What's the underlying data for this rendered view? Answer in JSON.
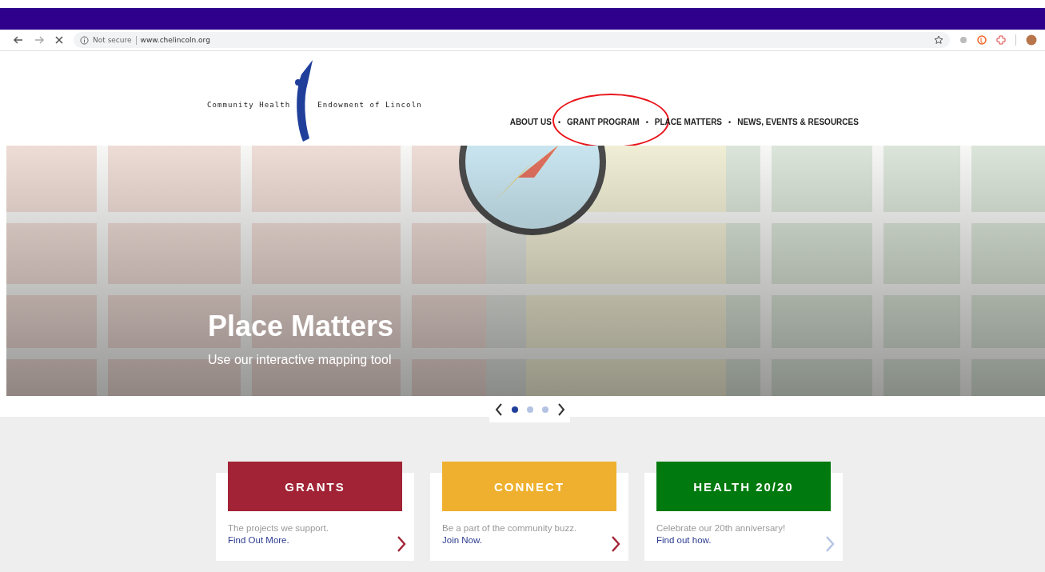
{
  "browser": {
    "security": "Not secure",
    "url": "www.chelincoln.org"
  },
  "logo": {
    "left": "Community Health",
    "right": "Endowment of Lincoln"
  },
  "nav": [
    {
      "label": "ABOUT US",
      "selected": false,
      "circled": false
    },
    {
      "label": "GRANT PROGRAM",
      "selected": false,
      "circled": true
    },
    {
      "label": "PLACE MATTERS",
      "selected": false,
      "circled": false
    },
    {
      "label": "NEWS, EVENTS & RESOURCES",
      "selected": false,
      "circled": false
    }
  ],
  "nav_separator": "•",
  "hero": {
    "title": "Place Matters",
    "subtitle": "Use our interactive mapping tool"
  },
  "slider_dots": [
    {
      "selected": true
    },
    {
      "selected": false
    },
    {
      "selected": false
    }
  ],
  "cards": [
    {
      "title": "GRANTS",
      "color": "#a12335",
      "text": "The projects we support. ",
      "link": "Find Out More.",
      "arrow_faded": false
    },
    {
      "title": "CONNECT",
      "color": "#eeb02e",
      "text": "Be a part of the community buzz. ",
      "link": "Join Now.",
      "arrow_faded": false
    },
    {
      "title": "HEALTH 20/20",
      "color": "#007a0e",
      "text": "Celebrate our 20th anniversary! ",
      "link": "Find out how.",
      "arrow_faded": true
    }
  ]
}
